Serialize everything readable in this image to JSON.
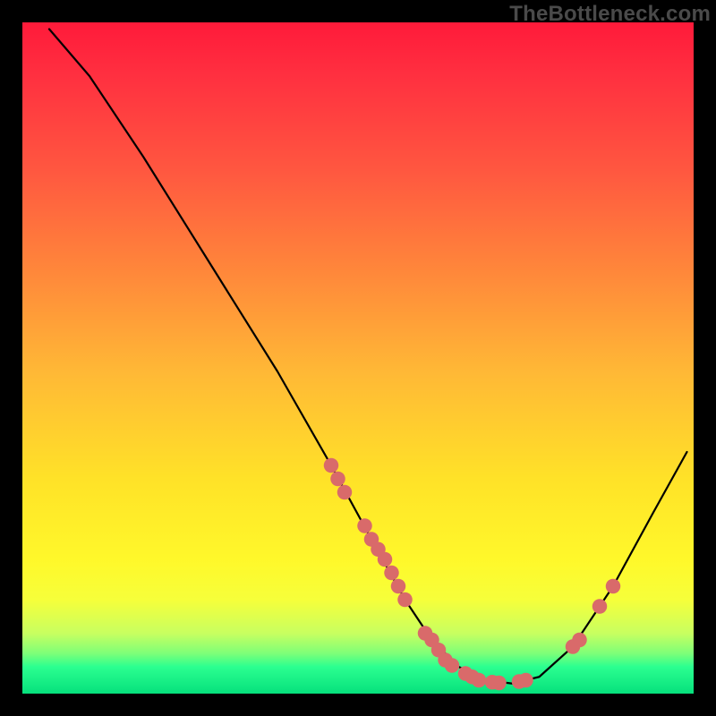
{
  "watermark": "TheBottleneck.com",
  "chart_data": {
    "type": "line",
    "title": "",
    "xlabel": "",
    "ylabel": "",
    "xlim": [
      0,
      100
    ],
    "ylim": [
      0,
      100
    ],
    "grid": false,
    "legend": false,
    "curve": [
      {
        "x": 4,
        "y": 99
      },
      {
        "x": 10,
        "y": 92
      },
      {
        "x": 18,
        "y": 80
      },
      {
        "x": 28,
        "y": 64
      },
      {
        "x": 38,
        "y": 48
      },
      {
        "x": 46,
        "y": 34
      },
      {
        "x": 52,
        "y": 23
      },
      {
        "x": 57,
        "y": 14
      },
      {
        "x": 61,
        "y": 8
      },
      {
        "x": 65,
        "y": 4
      },
      {
        "x": 69,
        "y": 2
      },
      {
        "x": 73,
        "y": 1.5
      },
      {
        "x": 77,
        "y": 2.5
      },
      {
        "x": 82,
        "y": 7
      },
      {
        "x": 88,
        "y": 16
      },
      {
        "x": 94,
        "y": 27
      },
      {
        "x": 99,
        "y": 36
      }
    ],
    "scatter_points": [
      {
        "x": 46,
        "y": 34
      },
      {
        "x": 47,
        "y": 32
      },
      {
        "x": 48,
        "y": 30
      },
      {
        "x": 51,
        "y": 25
      },
      {
        "x": 52,
        "y": 23
      },
      {
        "x": 53,
        "y": 21.5
      },
      {
        "x": 54,
        "y": 20
      },
      {
        "x": 55,
        "y": 18
      },
      {
        "x": 56,
        "y": 16
      },
      {
        "x": 57,
        "y": 14
      },
      {
        "x": 60,
        "y": 9
      },
      {
        "x": 61,
        "y": 8
      },
      {
        "x": 62,
        "y": 6.5
      },
      {
        "x": 63,
        "y": 5
      },
      {
        "x": 64,
        "y": 4.2
      },
      {
        "x": 66,
        "y": 3
      },
      {
        "x": 67,
        "y": 2.5
      },
      {
        "x": 68,
        "y": 2
      },
      {
        "x": 70,
        "y": 1.7
      },
      {
        "x": 71,
        "y": 1.6
      },
      {
        "x": 74,
        "y": 1.8
      },
      {
        "x": 75,
        "y": 2
      },
      {
        "x": 82,
        "y": 7
      },
      {
        "x": 83,
        "y": 8
      },
      {
        "x": 86,
        "y": 13
      },
      {
        "x": 88,
        "y": 16
      }
    ],
    "colors": {
      "curve": "#000000",
      "points": "#d96a6a",
      "gradient_top": "#ff1a3a",
      "gradient_bottom": "#06e07c"
    }
  }
}
